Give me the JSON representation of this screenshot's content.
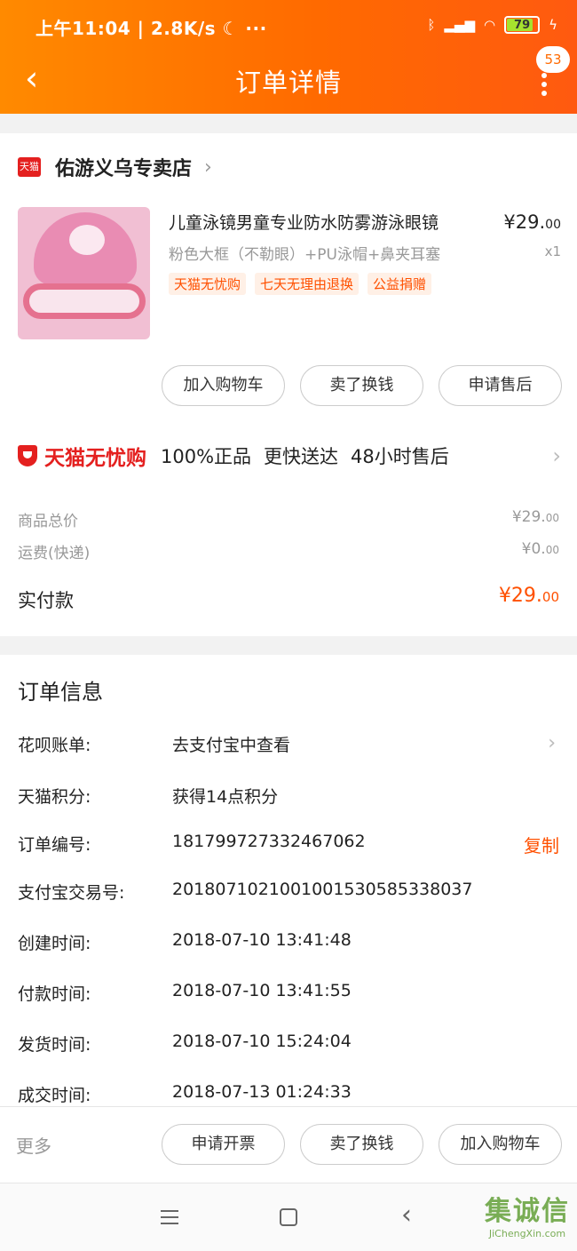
{
  "status_bar": {
    "time": "上午11:04 | 2.8K/s ☾  ···",
    "battery": "79"
  },
  "header": {
    "back_icon": "‹",
    "title": "订单详情",
    "badge_count": "53"
  },
  "shop": {
    "logo": "天猫",
    "name": "佑游义乌专卖店",
    "chevron": "›"
  },
  "product": {
    "name": "儿童泳镜男童专业防水防雾游泳眼镜",
    "sku": "粉色大框（不勒眼）+PU泳帽+鼻夹耳塞",
    "price_int": "¥29.",
    "price_dec": "00",
    "qty": "x1",
    "tags": [
      "天猫无忧购",
      "七天无理由退换",
      "公益捐赠"
    ]
  },
  "item_actions": [
    "加入购物车",
    "卖了换钱",
    "申请售后"
  ],
  "wuyou": {
    "brand": "天猫无忧购",
    "features": [
      "100%正品",
      "更快送达",
      "48小时售后"
    ]
  },
  "fees": {
    "total_label": "商品总价",
    "total_int": "¥29.",
    "total_dec": "00",
    "shipping_label": "运费(快递)",
    "shipping_int": "¥0.",
    "shipping_dec": "00",
    "paid_label": "实付款",
    "paid_int": "¥29.",
    "paid_dec": "00"
  },
  "order_info": {
    "title": "订单信息",
    "rows": [
      {
        "key": "花呗账单:",
        "value": "去支付宝中查看"
      },
      {
        "key": "天猫积分:",
        "value": "获得14点积分"
      },
      {
        "key": "订单编号:",
        "value": "181799727332467062",
        "action": "复制"
      },
      {
        "key": "支付宝交易号:",
        "value": "2018071021001001530585338037"
      },
      {
        "key": "创建时间:",
        "value": "2018-07-10 13:41:48"
      },
      {
        "key": "付款时间:",
        "value": "2018-07-10 13:41:55"
      },
      {
        "key": "发货时间:",
        "value": "2018-07-10 15:24:04"
      },
      {
        "key": "成交时间:",
        "value": "2018-07-13 01:24:33"
      }
    ]
  },
  "bottom_bar": {
    "more": "更多",
    "buttons": [
      "申请开票",
      "卖了换钱",
      "加入购物车"
    ]
  },
  "watermark": {
    "text": "集诚信",
    "sub": "JiChengXin.com"
  },
  "colors": {
    "accent": "#ff5000",
    "header": "#ff6a00",
    "tmall_red": "#e4201f"
  }
}
